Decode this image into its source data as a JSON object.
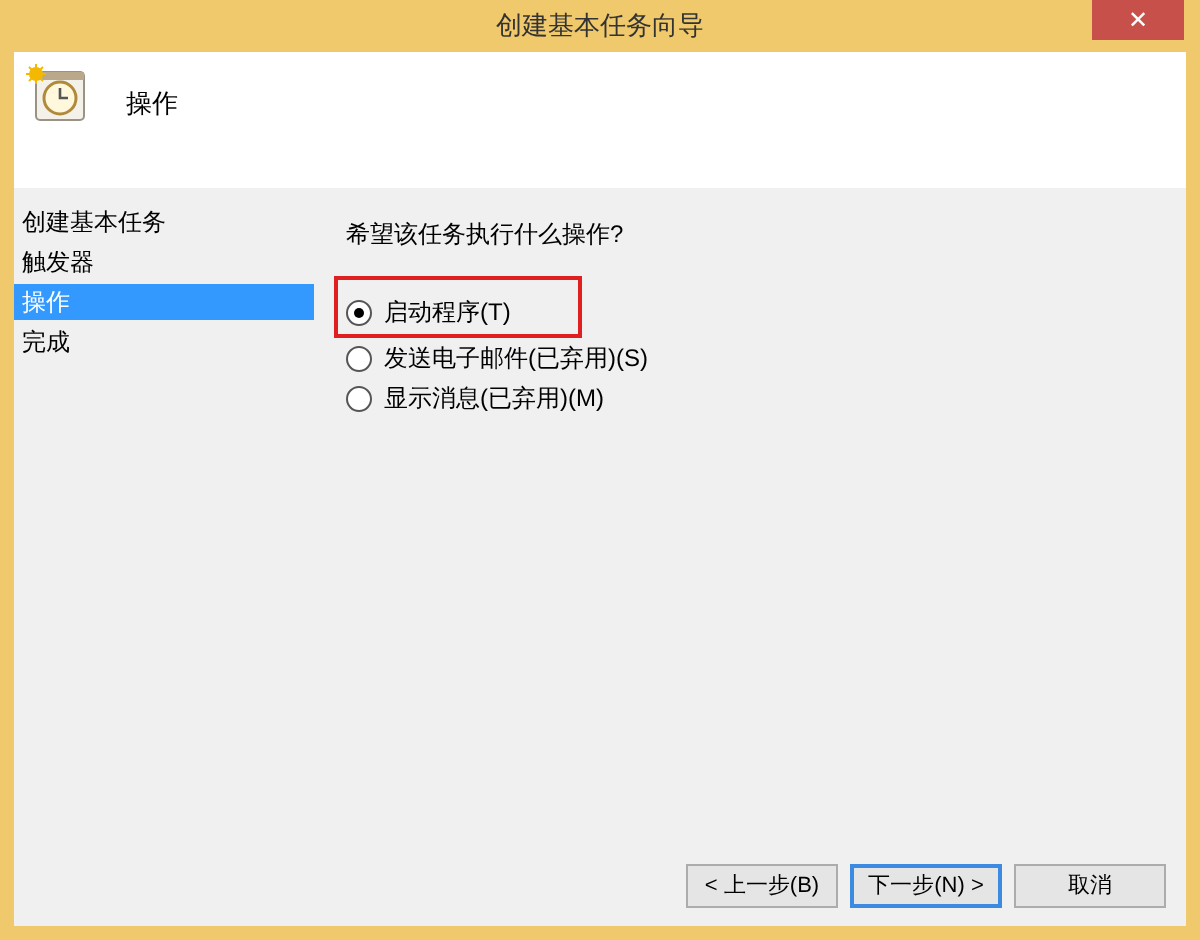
{
  "window": {
    "title": "创建基本任务向导",
    "close": "✕"
  },
  "header": {
    "title": "操作"
  },
  "sidebar": {
    "items": [
      {
        "label": "创建基本任务",
        "selected": false
      },
      {
        "label": "触发器",
        "selected": false
      },
      {
        "label": "操作",
        "selected": true
      },
      {
        "label": "完成",
        "selected": false
      }
    ]
  },
  "content": {
    "question": "希望该任务执行什么操作?",
    "options": [
      {
        "label": "启动程序(T)",
        "selected": true,
        "highlighted": true
      },
      {
        "label": "发送电子邮件(已弃用)(S)",
        "selected": false,
        "highlighted": false
      },
      {
        "label": "显示消息(已弃用)(M)",
        "selected": false,
        "highlighted": false
      }
    ]
  },
  "buttons": [
    {
      "label": "< 上一步(B)",
      "default": false
    },
    {
      "label": "下一步(N) >",
      "default": true
    },
    {
      "label": "取消",
      "default": false
    }
  ]
}
